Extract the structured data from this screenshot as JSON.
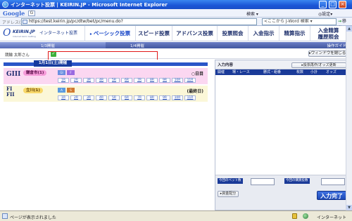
{
  "window": {
    "title": "インターネット投票 | KEIRIN.JP - Microsoft Internet Explorer",
    "min": "_",
    "max": "□",
    "close": "×"
  },
  "google_bar": {
    "logo": "Google",
    "search_button": "G",
    "search_menu": "検索 ▾",
    "settings": "◎設定▾"
  },
  "address_bar": {
    "label": "アドレス(D)",
    "url": "https://test.keirin.jp/pc/dtw/bet/pc/menu.do?",
    "search_placeholder": "<ここから J-Word 検索 ▾",
    "go": "移動"
  },
  "header": {
    "logo_text": "KEIRIN.JP",
    "logo_subtitle": "インターネット投票",
    "logo_tagline": "Internet keirin betting",
    "nav": [
      {
        "label": "ベーシック投票"
      },
      {
        "label": "スピード投票"
      },
      {
        "label": "アドバンス投票"
      },
      {
        "label": "投票照会"
      },
      {
        "label": "入金指示"
      },
      {
        "label": "精算指示"
      },
      {
        "label": "入金精算",
        "label2": "履歴照会"
      }
    ]
  },
  "steps": {
    "step1": "1/3開催",
    "step2": "1/4開催",
    "guide": "操作ガイド"
  },
  "user": {
    "name": "競輪 太郎さん",
    "check_icon_label": "✓",
    "close_window_button": "▸ウィンドウを閉じる"
  },
  "race_list": {
    "date_label": "1月1日(土)開催",
    "rows": [
      {
        "grade": "GIII",
        "venue": "鎌倉市(1)",
        "day_label": "○日目",
        "badges": [
          "GI",
          "F"
        ],
        "races": [
          "1R",
          "2R",
          "3R",
          "4R",
          "5R",
          "6R",
          "7R",
          "8R",
          "9R",
          "10R",
          "11R"
        ]
      },
      {
        "grade": "FI",
        "grade2": "FII",
        "venue": "立川(1)",
        "day_label": "(最終日)",
        "badges": [
          "A",
          "S"
        ],
        "races": [
          "1R",
          "2R",
          "3R",
          "4R",
          "5R",
          "6R",
          "7R",
          "8R",
          "9R",
          "10R",
          "11R"
        ]
      }
    ]
  },
  "bet_panel": {
    "title": "入力内容",
    "refresh_button": "▸投票再作/オッズ更新",
    "columns": [
      "開催",
      "場・レース",
      "勝式・組番",
      "枚数",
      "小計",
      "オッズ"
    ],
    "bet_count_label": "今回のベット数",
    "total_amount_label": "今回の購買投数",
    "fund_button": "▸資金配分",
    "done_button": "入力完了"
  },
  "status_bar": {
    "message": "ページが表示されました",
    "zone": "インターネット"
  },
  "colors": {
    "title_bar": "#1b55d6",
    "highlight_box": "#e01818",
    "pink_row": "#fbd7f1",
    "cream_row": "#fbf7d8",
    "panel_header": "#1a3a98"
  }
}
